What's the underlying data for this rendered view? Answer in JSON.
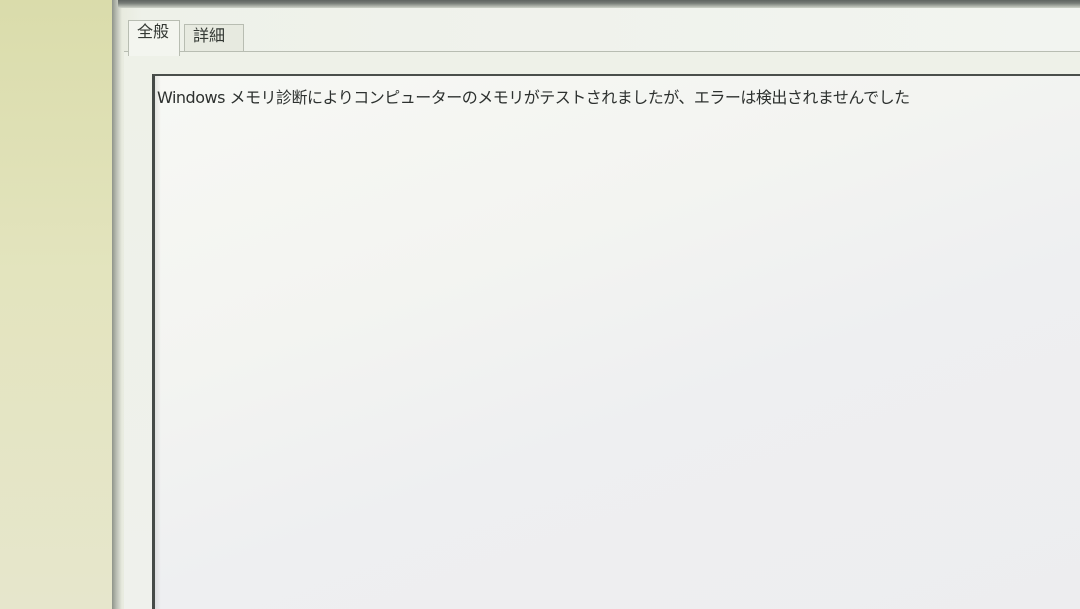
{
  "tabs": [
    {
      "label": "全般",
      "active": true
    },
    {
      "label": "詳細",
      "active": false
    }
  ],
  "message": {
    "text": "Windows メモリ診断によりコンピューターのメモリがテストされましたが、エラーは検出されませんでした"
  }
}
